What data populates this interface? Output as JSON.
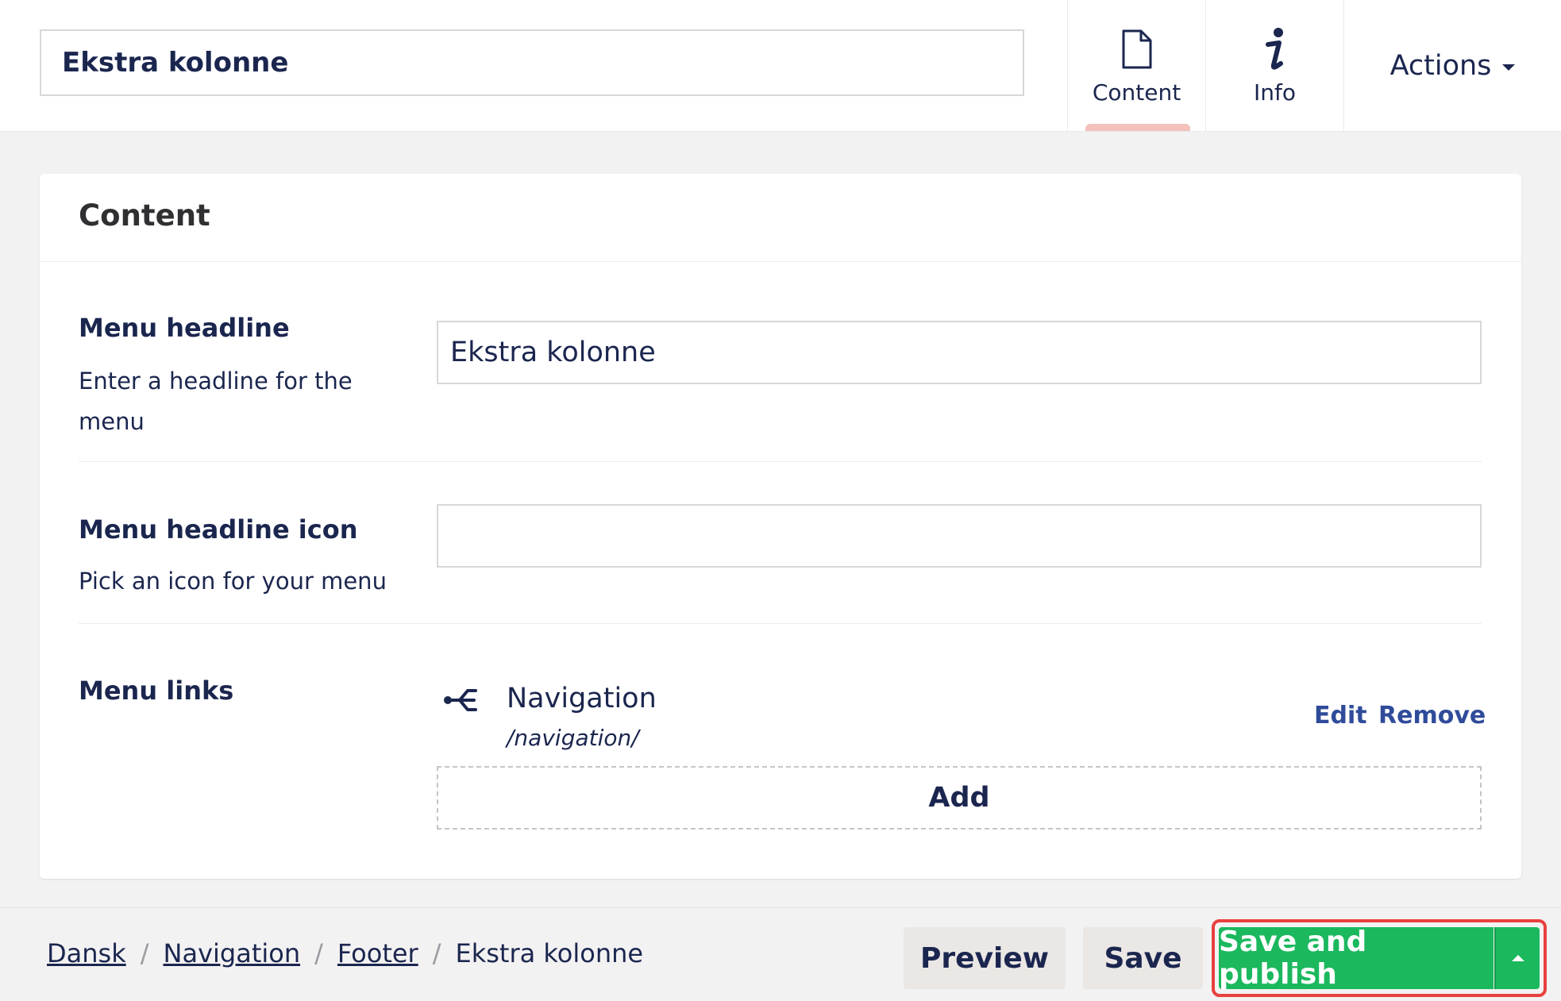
{
  "header": {
    "name_value": "Ekstra kolonne",
    "tabs": [
      {
        "label": "Content",
        "icon": "document-icon",
        "active": true
      },
      {
        "label": "Info",
        "icon": "info-icon",
        "active": false
      }
    ],
    "actions_label": "Actions"
  },
  "content_box": {
    "title": "Content",
    "properties": {
      "menu_headline": {
        "label": "Menu headline",
        "description": "Enter a headline for the menu",
        "value": "Ekstra kolonne"
      },
      "menu_headline_icon": {
        "label": "Menu headline icon",
        "description": "Pick an icon for your menu",
        "value": ""
      },
      "menu_links": {
        "label": "Menu links",
        "items": [
          {
            "name": "Navigation",
            "url": "/navigation/",
            "icon": "sitemap-icon"
          }
        ],
        "edit_label": "Edit",
        "remove_label": "Remove",
        "add_label": "Add"
      }
    }
  },
  "footer": {
    "breadcrumb": [
      "Dansk",
      "Navigation",
      "Footer"
    ],
    "breadcrumb_separator": "/",
    "breadcrumb_current": "Ekstra kolonne",
    "preview_label": "Preview",
    "save_label": "Save",
    "save_publish_label": "Save and publish"
  },
  "colors": {
    "primary_text": "#1b264f",
    "publish_green": "#1bb85e",
    "highlight_red": "#e8413f",
    "active_tab_indicator": "#f5c1bc"
  }
}
